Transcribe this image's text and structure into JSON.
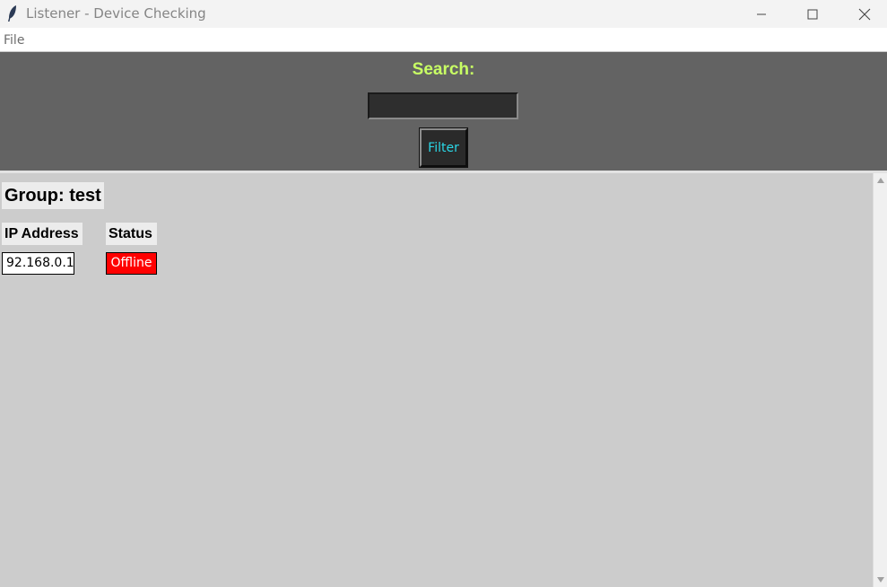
{
  "window": {
    "title": "Listener - Device Checking",
    "icon": "feather-icon",
    "controls": [
      "minimize-icon",
      "maximize-icon",
      "close-icon"
    ]
  },
  "menu": {
    "items": [
      {
        "label": "File"
      }
    ]
  },
  "search": {
    "label": "Search:",
    "value": "",
    "filter_label": "Filter"
  },
  "group": {
    "title": "Group: test",
    "columns": [
      "IP Address",
      "Status"
    ],
    "rows": [
      {
        "ip": "92.168.0.1",
        "status": "Offline"
      }
    ]
  },
  "colors": {
    "search_label": "#c8ff64",
    "filter_text": "#2ad7e6",
    "offline": "#ff0000",
    "panel": "#636363",
    "content_bg": "#cccccc"
  }
}
